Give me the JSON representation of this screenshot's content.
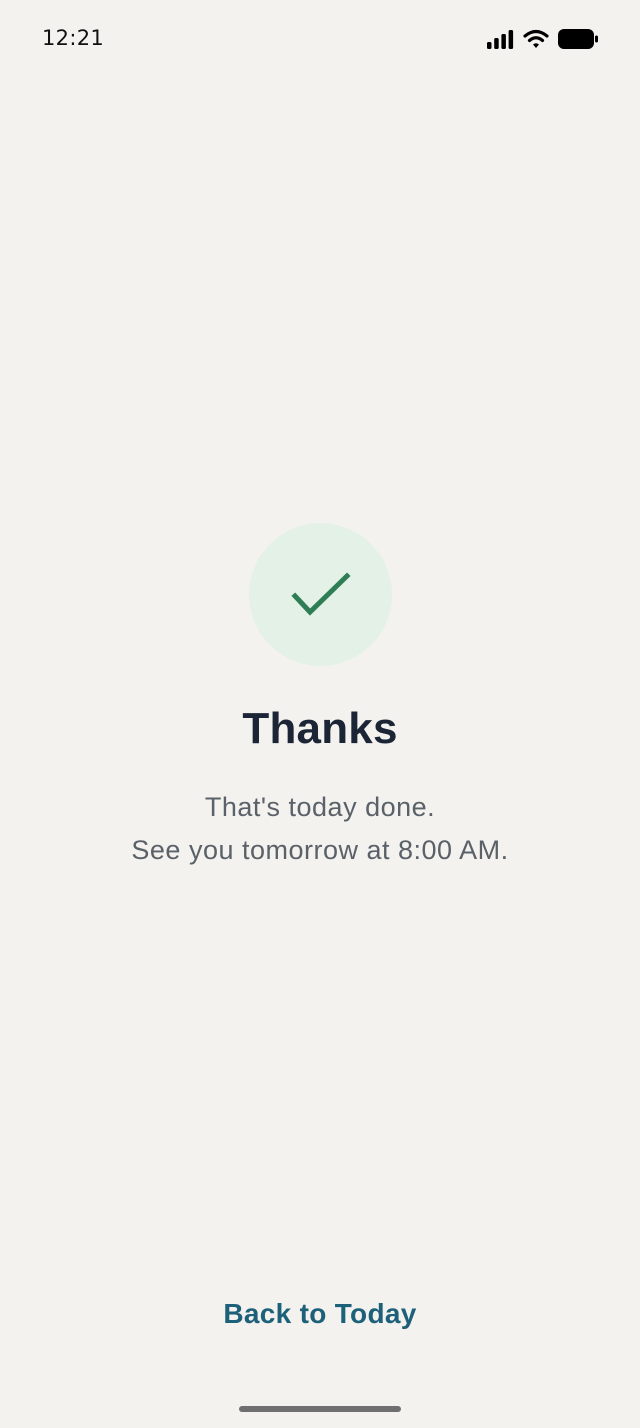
{
  "status_bar": {
    "time": "12:21",
    "icons": [
      "signal-icon",
      "wifi-icon",
      "battery-icon"
    ]
  },
  "confirmation": {
    "icon": "checkmark-icon",
    "title": "Thanks",
    "line1": "That's today done.",
    "line2": "See you tomorrow at 8:00 AM."
  },
  "actions": {
    "back_label": "Back to Today"
  },
  "colors": {
    "background": "#f3f2ef",
    "check_bg": "#e3f1e7",
    "check_stroke": "#2e7d55",
    "title": "#1c2535",
    "message": "#5a6168",
    "link": "#1d6079"
  }
}
